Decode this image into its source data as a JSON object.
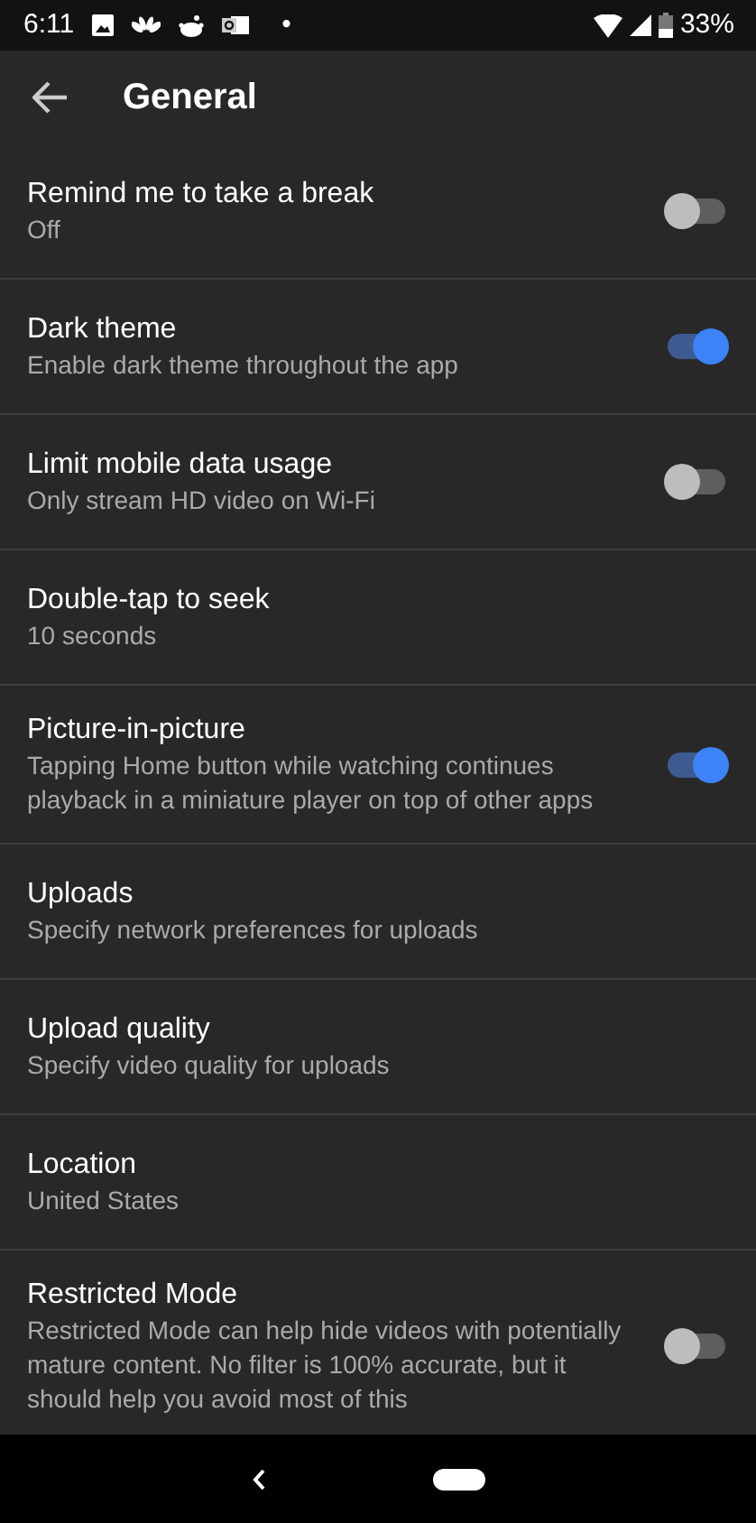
{
  "status_bar": {
    "time": "6:11",
    "dot": "•",
    "battery": "33%"
  },
  "header": {
    "title": "General"
  },
  "settings": [
    {
      "kind": "toggle",
      "title": "Remind me to take a break",
      "subtitle": "Off",
      "on": false
    },
    {
      "kind": "toggle",
      "title": "Dark theme",
      "subtitle": "Enable dark theme throughout the app",
      "on": true
    },
    {
      "kind": "toggle",
      "title": "Limit mobile data usage",
      "subtitle": "Only stream HD video on Wi-Fi",
      "on": false
    },
    {
      "kind": "plain",
      "title": "Double-tap to seek",
      "subtitle": "10 seconds"
    },
    {
      "kind": "toggle",
      "title": "Picture-in-picture",
      "subtitle": "Tapping Home button while watching continues playback in a miniature player on top of other apps",
      "on": true
    },
    {
      "kind": "plain",
      "title": "Uploads",
      "subtitle": "Specify network preferences for uploads"
    },
    {
      "kind": "plain",
      "title": "Upload quality",
      "subtitle": "Specify video quality for uploads"
    },
    {
      "kind": "plain",
      "title": "Location",
      "subtitle": "United States"
    },
    {
      "kind": "toggle",
      "title": "Restricted Mode",
      "subtitle": "Restricted Mode can help hide videos with potentially mature content. No filter is 100% accurate, but it should help you avoid most of this",
      "on": false
    }
  ]
}
